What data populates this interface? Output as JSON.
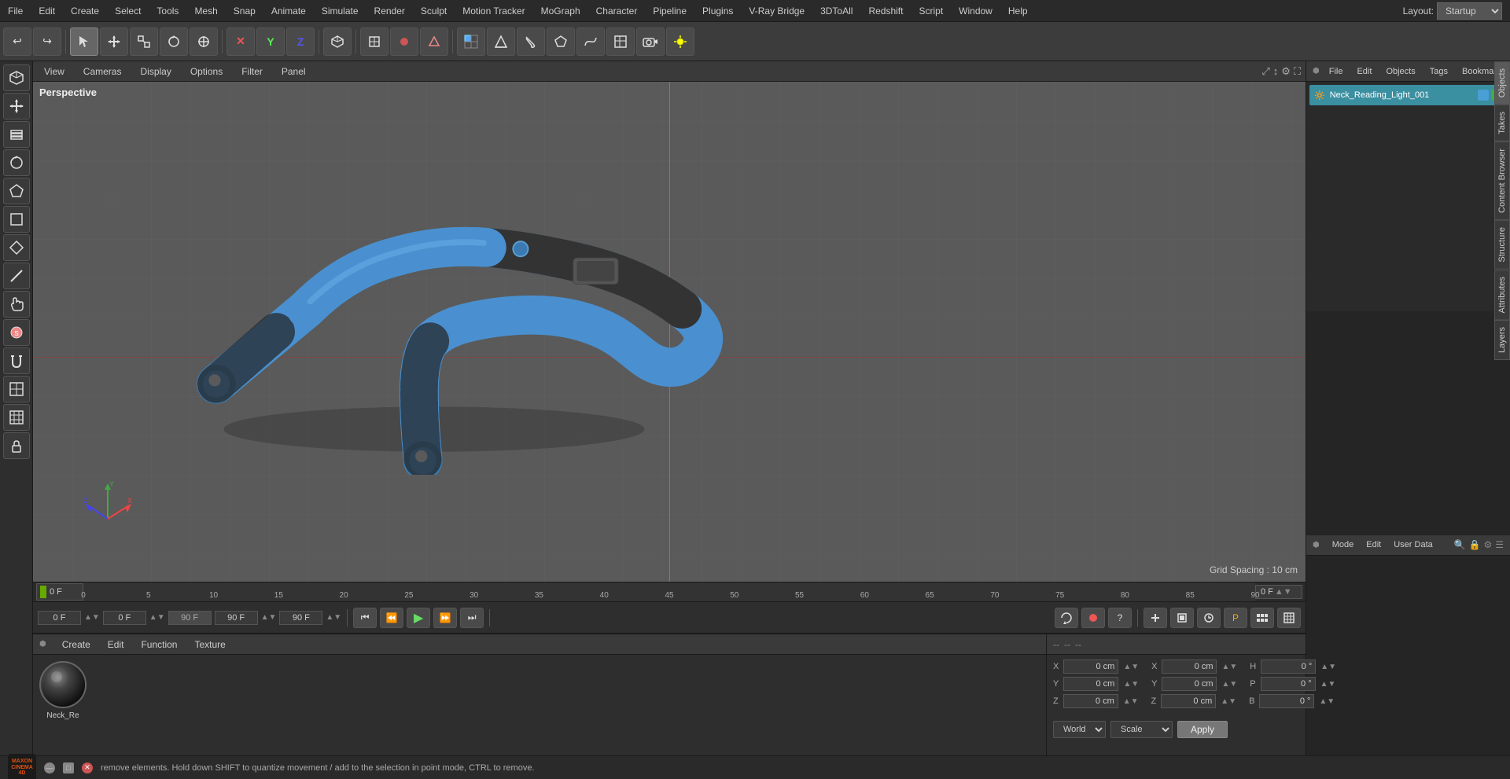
{
  "app": {
    "title": "Cinema 4D",
    "layout_label": "Layout:",
    "layout_value": "Startup"
  },
  "top_menu": {
    "items": [
      "File",
      "Edit",
      "Create",
      "Select",
      "Tools",
      "Mesh",
      "Snap",
      "Animate",
      "Simulate",
      "Render",
      "Sculpt",
      "Motion Tracker",
      "MoGraph",
      "Character",
      "Pipeline",
      "Plugins",
      "V-Ray Bridge",
      "3DToAll",
      "Redshift",
      "Script",
      "Window",
      "Help"
    ]
  },
  "toolbar": {
    "undo_icon": "↩",
    "redo_icon": "↪",
    "tools": [
      "▶",
      "✛",
      "□",
      "⟳",
      "✛",
      "✕",
      "Y",
      "Z",
      "⬡",
      "▶▶",
      "▶|",
      "▶",
      "⬛",
      "□",
      "⬡",
      "⚙",
      "🔲",
      "○",
      "★",
      "◆",
      "◈",
      "⬜",
      "🔑",
      "○",
      "🔆"
    ]
  },
  "left_sidebar": {
    "tools": [
      "□",
      "✛",
      "⟳",
      "⬟",
      "⬡",
      "⬢",
      "◈",
      "L",
      "✋",
      "S",
      "⟲",
      "⬢",
      "⬜",
      "🔒"
    ]
  },
  "viewport": {
    "perspective_label": "Perspective",
    "menu": [
      "View",
      "Cameras",
      "Display",
      "Options",
      "Filter",
      "Panel"
    ],
    "grid_spacing": "Grid Spacing : 10 cm"
  },
  "timeline": {
    "start_frame": "0 F",
    "end_frame": "90 F",
    "current_frame": "0 F",
    "preview_start": "0 F",
    "preview_end": "90 F",
    "frame_display": "0 F",
    "marks": [
      "0",
      "5",
      "10",
      "15",
      "20",
      "25",
      "30",
      "35",
      "40",
      "45",
      "50",
      "55",
      "60",
      "65",
      "70",
      "75",
      "80",
      "85",
      "90"
    ]
  },
  "playback": {
    "frame_start": "0 F",
    "frame_current": "0 F",
    "frame_end": "90 F",
    "preview_end": "90 F",
    "buttons": [
      "⏮",
      "⏪",
      "⏩",
      "▶",
      "⏭",
      "⏭⏭"
    ]
  },
  "material_panel": {
    "menu": [
      "Create",
      "Edit",
      "Function",
      "Texture"
    ],
    "materials": [
      {
        "name": "Neck_Re",
        "type": "sphere"
      }
    ]
  },
  "coords_panel": {
    "header": [
      "--",
      "--",
      "--"
    ],
    "position": {
      "x": "0 cm",
      "y": "0 cm",
      "z": "0 cm"
    },
    "rotation": {
      "h": "0 °",
      "p": "0 °",
      "b": "0 °"
    },
    "scale": {
      "x": "0 cm",
      "y": "0 cm",
      "z": "0 cm"
    },
    "coord_system": "World",
    "coord_mode": "Scale",
    "apply_label": "Apply"
  },
  "right_panel": {
    "header_menus": [
      "File",
      "Edit",
      "Objects",
      "Tags",
      "Bookmarks"
    ],
    "object_name": "Neck_Reading_Light_001",
    "attr_menus": [
      "Mode",
      "Edit",
      "User Data"
    ],
    "tabs": [
      "Objects",
      "Takes",
      "Content Browser",
      "Structure",
      "Attributes",
      "Layers"
    ]
  },
  "status_bar": {
    "text": "remove elements. Hold down SHIFT to quantize movement / add to the selection in point mode, CTRL to remove."
  }
}
